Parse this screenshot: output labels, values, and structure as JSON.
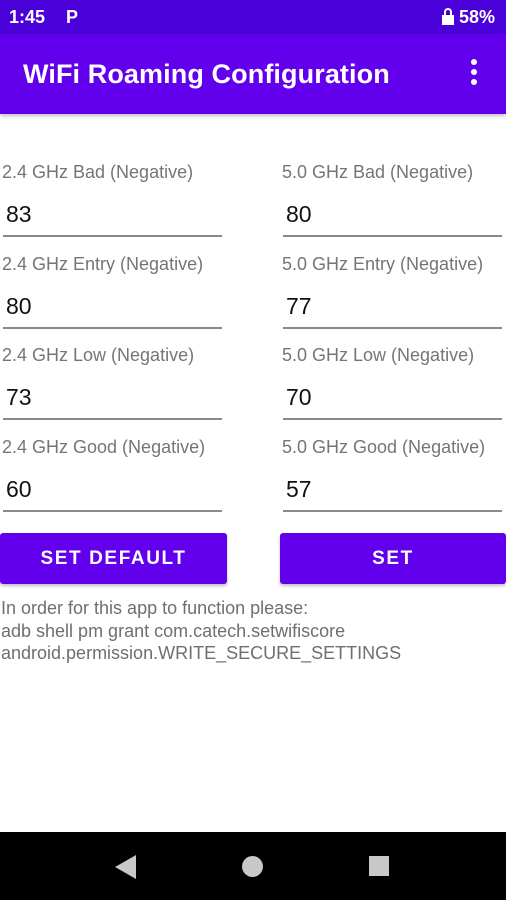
{
  "status_bar": {
    "time": "1:45",
    "notification_letter": "P",
    "battery": "58%",
    "icons": [
      "parking-icon",
      "battery-lock-icon"
    ]
  },
  "app_bar": {
    "title": "WiFi Roaming Configuration",
    "overflow_icon": "more-vert-icon",
    "color": "#6200ee"
  },
  "fields_24": [
    {
      "label": "2.4 GHz Bad (Negative)",
      "value": "83"
    },
    {
      "label": "2.4 GHz Entry (Negative)",
      "value": "80"
    },
    {
      "label": "2.4 GHz Low (Negative)",
      "value": "73"
    },
    {
      "label": "2.4 GHz Good (Negative)",
      "value": "60"
    }
  ],
  "fields_50": [
    {
      "label": "5.0 GHz Bad (Negative)",
      "value": "80"
    },
    {
      "label": "5.0 GHz Entry (Negative)",
      "value": "77"
    },
    {
      "label": "5.0 GHz Low (Negative)",
      "value": "70"
    },
    {
      "label": "5.0 GHz Good (Negative)",
      "value": "57"
    }
  ],
  "buttons": {
    "set_default": "SET DEFAULT",
    "set": "SET"
  },
  "info_lines": [
    "In order for this app to function please:",
    "adb shell pm grant com.catech.setwifiscore",
    "android.permission.WRITE_SECURE_SETTINGS"
  ],
  "nav_bar": {
    "icons": [
      "back-icon",
      "home-icon",
      "recents-icon"
    ]
  }
}
